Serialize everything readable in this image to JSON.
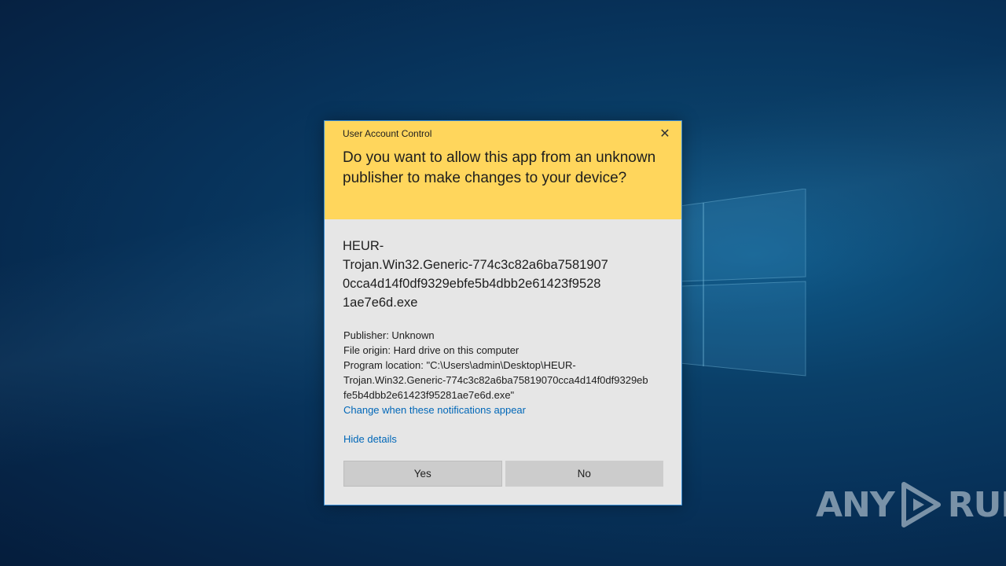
{
  "dialog": {
    "title": "User Account Control",
    "close_icon": "close-icon",
    "question": "Do you want to allow this app from an unknown publisher to make changes to your device?",
    "app_name_lines": [
      "HEUR-",
      "Trojan.Win32.Generic-774c3c82a6ba7581907",
      "0cca4d14f0df9329ebfe5b4dbb2e61423f9528",
      "1ae7e6d.exe"
    ],
    "publisher": "Publisher: Unknown",
    "file_origin": "File origin: Hard drive on this computer",
    "program_location_lines": [
      "Program location: \"C:\\Users\\admin\\Desktop\\HEUR-",
      "Trojan.Win32.Generic-774c3c82a6ba75819070cca4d14f0df9329eb",
      "fe5b4dbb2e61423f95281ae7e6d.exe\""
    ],
    "change_link": "Change when these notifications appear",
    "hide_details": "Hide details",
    "yes_label": "Yes",
    "no_label": "No"
  },
  "watermark": {
    "left": "ANY",
    "right": "RUN"
  },
  "colors": {
    "header": "#ffd65c",
    "body": "#e6e6e6",
    "link": "#0067b8",
    "button": "#cccccc",
    "border": "#3c8fd6"
  }
}
